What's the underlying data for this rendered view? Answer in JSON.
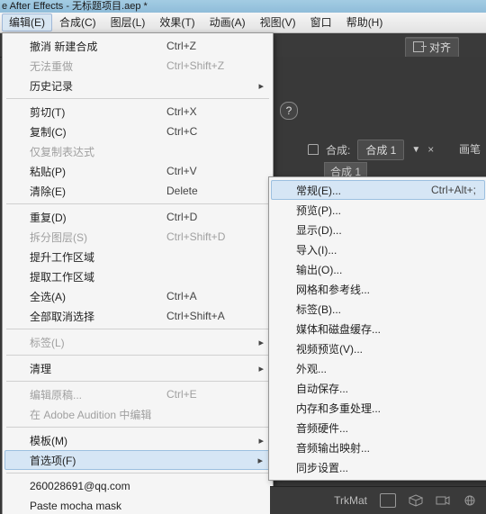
{
  "title": "e After Effects - 无标题项目.aep *",
  "menubar": [
    {
      "label": "编辑(E)",
      "open": true
    },
    {
      "label": "合成(C)"
    },
    {
      "label": "图层(L)"
    },
    {
      "label": "效果(T)"
    },
    {
      "label": "动画(A)"
    },
    {
      "label": "视图(V)"
    },
    {
      "label": "窗口"
    },
    {
      "label": "帮助(H)"
    }
  ],
  "toolbar": {
    "align": "对齐"
  },
  "help_icon": "?",
  "comp": {
    "prefix": "合成:",
    "name": "合成 1",
    "row2": "合成 1",
    "brush": "画笔"
  },
  "editmenu": [
    {
      "label": "撤消 新建合成",
      "accel": "Ctrl+Z"
    },
    {
      "label": "无法重做",
      "accel": "Ctrl+Shift+Z",
      "disabled": true
    },
    {
      "label": "历史记录",
      "sub": true
    },
    {
      "sep": true
    },
    {
      "label": "剪切(T)",
      "accel": "Ctrl+X"
    },
    {
      "label": "复制(C)",
      "accel": "Ctrl+C"
    },
    {
      "label": "仅复制表达式",
      "disabled": true
    },
    {
      "label": "粘贴(P)",
      "accel": "Ctrl+V"
    },
    {
      "label": "清除(E)",
      "accel": "Delete"
    },
    {
      "sep": true
    },
    {
      "label": "重复(D)",
      "accel": "Ctrl+D"
    },
    {
      "label": "拆分图层(S)",
      "accel": "Ctrl+Shift+D",
      "disabled": true
    },
    {
      "label": "提升工作区域"
    },
    {
      "label": "提取工作区域"
    },
    {
      "label": "全选(A)",
      "accel": "Ctrl+A"
    },
    {
      "label": "全部取消选择",
      "accel": "Ctrl+Shift+A"
    },
    {
      "sep": true
    },
    {
      "label": "标签(L)",
      "sub": true,
      "disabled": true
    },
    {
      "sep": true
    },
    {
      "label": "清理",
      "sub": true
    },
    {
      "sep": true
    },
    {
      "label": "编辑原稿...",
      "accel": "Ctrl+E",
      "disabled": true
    },
    {
      "label": "在 Adobe Audition 中编辑",
      "disabled": true
    },
    {
      "sep": true
    },
    {
      "label": "模板(M)",
      "sub": true
    },
    {
      "label": "首选项(F)",
      "sub": true,
      "highlight": true
    },
    {
      "sep": true
    },
    {
      "label": "260028691@qq.com"
    },
    {
      "label": "Paste mocha mask"
    }
  ],
  "submenu": [
    {
      "label": "常规(E)...",
      "accel": "Ctrl+Alt+;",
      "highlight": true
    },
    {
      "label": "预览(P)..."
    },
    {
      "label": "显示(D)..."
    },
    {
      "label": "导入(I)..."
    },
    {
      "label": "输出(O)..."
    },
    {
      "label": "网格和参考线..."
    },
    {
      "label": "标签(B)..."
    },
    {
      "label": "媒体和磁盘缓存..."
    },
    {
      "label": "视频预览(V)..."
    },
    {
      "label": "外观..."
    },
    {
      "label": "自动保存..."
    },
    {
      "label": "内存和多重处理..."
    },
    {
      "label": "音频硬件..."
    },
    {
      "label": "音频输出映射..."
    },
    {
      "label": "同步设置..."
    }
  ],
  "statusbar": {
    "label": "TrkMat"
  }
}
